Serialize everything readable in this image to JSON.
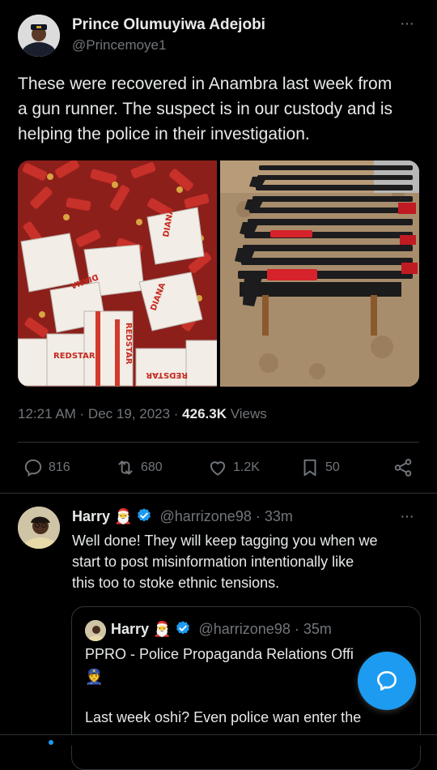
{
  "main_tweet": {
    "author_name": "Prince Olumuyiwa Adejobi",
    "author_handle": "@Princemoye1",
    "text_lines": [
      "These were recovered in Anambra last week from",
      "a gun runner. The suspect is in our custody and is",
      "helping the police in their investigation."
    ],
    "timestamp": "12:21 AM · Dec 19, 2023 · ",
    "views_count": "426.3K",
    "views_label": " Views",
    "box_label_1": "REDSTAR",
    "box_label_2": "DIANA"
  },
  "actions": {
    "replies": "816",
    "retweets": "680",
    "likes": "1.2K",
    "bookmarks": "50"
  },
  "reply": {
    "author_name": "Harry",
    "emoji": "🎅",
    "handle": "@harrizone98",
    "time": "· 33m",
    "text_lines": [
      "Well done! They will keep tagging you when we",
      "start to post misinformation intentionally like",
      "this too to stoke ethnic tensions."
    ]
  },
  "quoted": {
    "author_name": "Harry",
    "emoji": "🎅",
    "handle": "@harrizone98",
    "time": "· 35m",
    "line1": "PPRO - Police Propaganda Relations Offi",
    "line1_emoji": "👮",
    "line2": "Last week oshi? Even police wan enter the"
  },
  "more_icon": "···",
  "colors": {
    "accent": "#1d9bf0",
    "muted": "#71767b",
    "text": "#e7e9ea",
    "divider": "#2f3336"
  }
}
